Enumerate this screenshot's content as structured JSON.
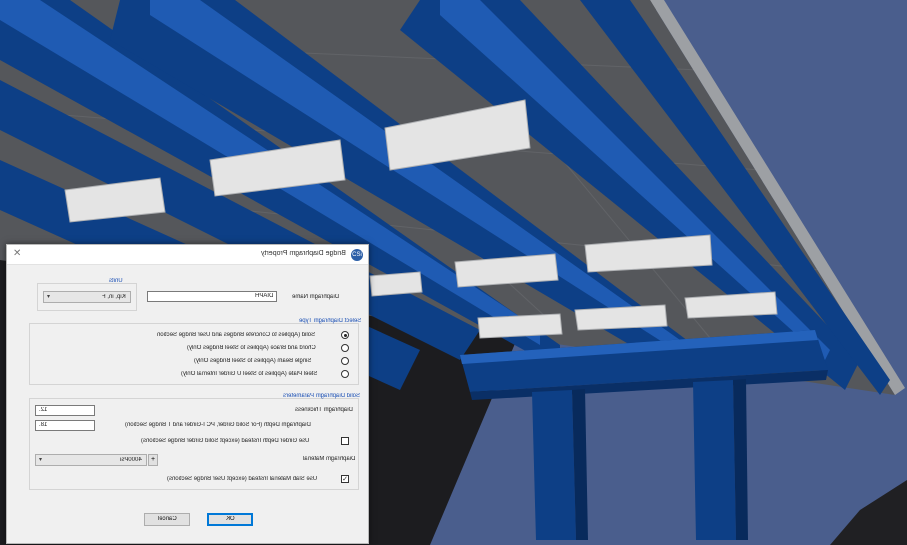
{
  "dialog": {
    "title": "Bridge Diaphragm Property",
    "close_glyph": "✕",
    "units": {
      "label": "Units",
      "value": "Kip, in, F"
    },
    "diaphragm_name": {
      "label": "Diaphragm Name",
      "value": "DIAPH"
    },
    "type_section": {
      "label": "Select Diaphragm Type",
      "options": [
        {
          "label": "Solid   (Applies to Concrete Bridges and User Bridge Section",
          "selected": true
        },
        {
          "label": "Chord and Brace   (Applies to Steel Bridges Only)",
          "selected": false
        },
        {
          "label": "Single Beam   (Applies to Steel Bridges Only)",
          "selected": false
        },
        {
          "label": "Steel Plate   (Applies to Steel U Girder Internal Only)",
          "selected": false
        }
      ]
    },
    "solid_section": {
      "label": "Solid Diaphragm Parameters",
      "thickness": {
        "label": "Diaphragm Thickness",
        "value": "12."
      },
      "depth": {
        "label": "Diaphragm Depth  (For Solid Girder, PC I-Girder and T Bridge Section)",
        "value": "18."
      },
      "use_girder_depth": {
        "label": "Use Girder Depth Instead (except Solid Girder Bridge Sections)",
        "checked": false
      },
      "material": {
        "label": "Diaphragm Material",
        "value": "4000Psi",
        "add_glyph": "+"
      },
      "use_slab_material": {
        "label": "Use Slab Material Instead (except User Bridge Sections)",
        "checked": true
      }
    },
    "buttons": {
      "ok": "OK",
      "cancel": "Cancel"
    }
  },
  "colors": {
    "girder_blue": "#0d3f86",
    "deck_gray": "#55575b",
    "diaphragm_white": "#e4e4e4",
    "background_slate": "#4a5e8d",
    "background_dark": "#1c1c1f"
  }
}
